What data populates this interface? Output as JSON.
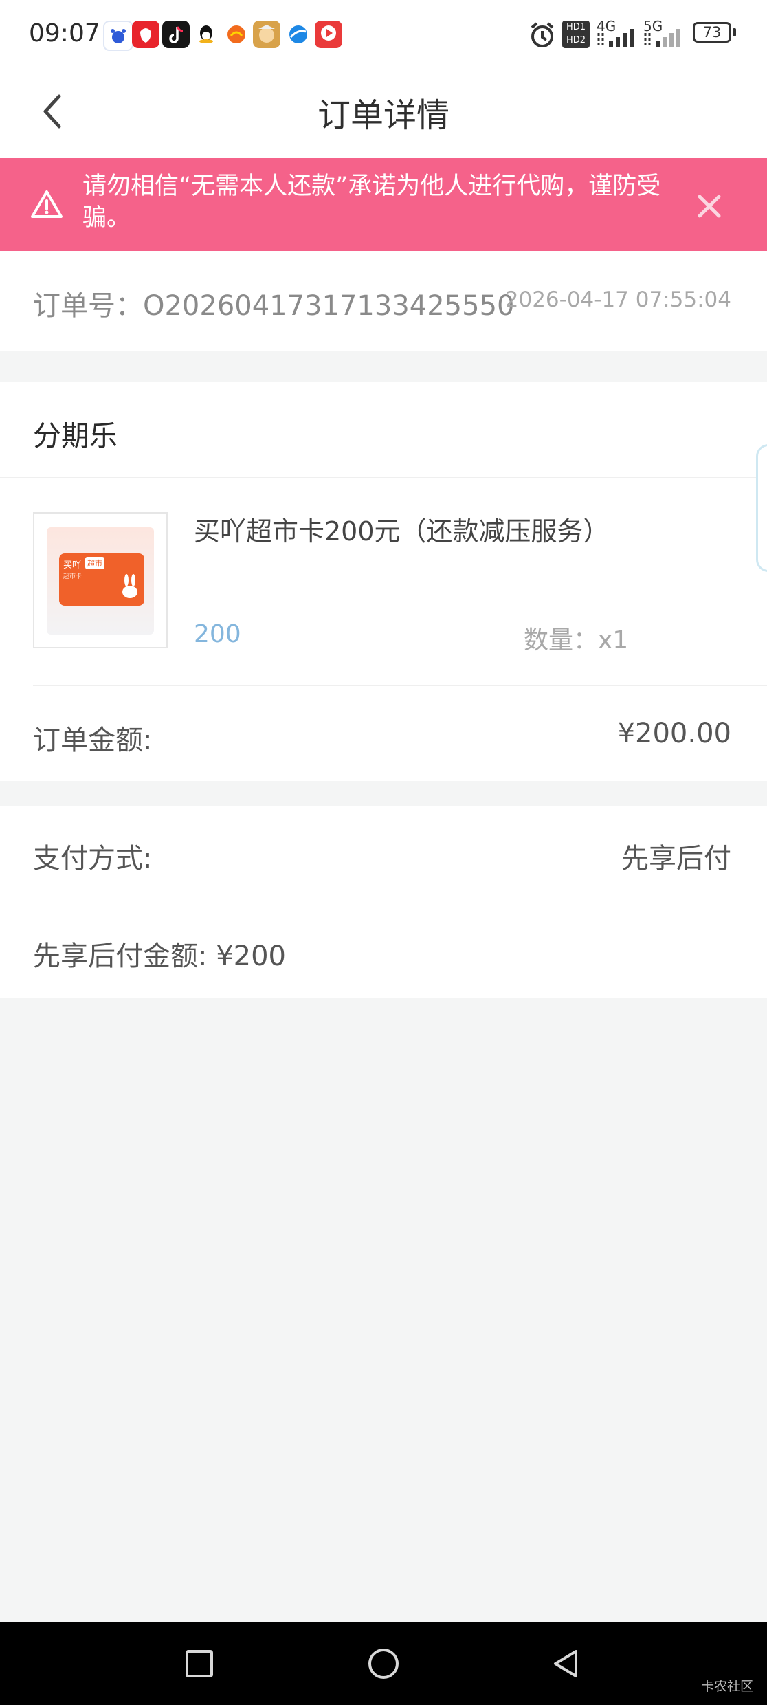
{
  "status_bar": {
    "time": "09:07",
    "network_hd": "HD1 HD2",
    "network_4g": "4G",
    "network_5g": "5G",
    "battery": "73",
    "apps": [
      "baidu-app-icon",
      "weibo-app-icon",
      "douyin-app-icon",
      "qq-app-icon",
      "orange-app-icon",
      "game-app-icon",
      "browser-app-icon",
      "video-app-icon"
    ]
  },
  "nav": {
    "title": "订单详情",
    "back_icon": "chevron-left-icon"
  },
  "banner": {
    "text": "请勿相信“无需本人还款”承诺为他人进行代购，谨防受骗。",
    "warning_icon": "warning-icon",
    "close_icon": "close-icon"
  },
  "order": {
    "number": "订单号：O202604173171334255​50",
    "time": "2026-04-17 07:55:04"
  },
  "section": {
    "title": "分期乐"
  },
  "product": {
    "name": "买吖超市卡200元（还款减压服务）",
    "value": "200",
    "quantity": "数量：x1",
    "card_brand": "买吖",
    "card_tag": "超市",
    "card_sub": "超市卡"
  },
  "amount": {
    "label": "订单金额:",
    "value": "¥200.00"
  },
  "payment": {
    "label": "支付方式:",
    "value": "先享后付"
  },
  "installment": {
    "text": "先享后付金额:  ¥200"
  },
  "watermark": "卡农社区",
  "colors": {
    "banner": "#f5628a",
    "price_blue": "#84b6dd",
    "card_orange": "#f0612a"
  }
}
